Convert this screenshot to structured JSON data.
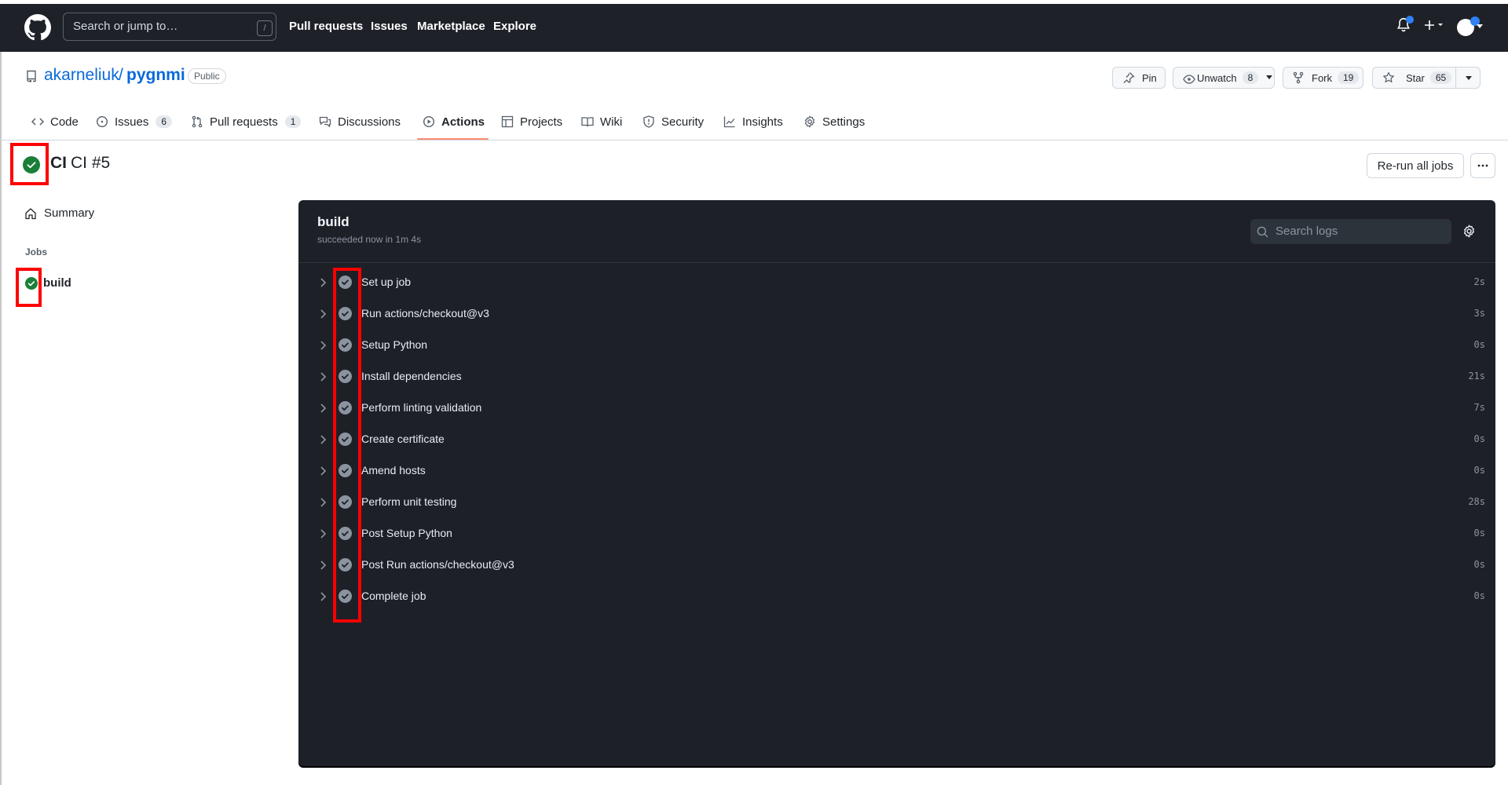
{
  "header": {
    "search_placeholder": "Search or jump to…",
    "search_shortcut": "/",
    "nav": [
      "Pull requests",
      "Issues",
      "Marketplace",
      "Explore"
    ],
    "icons": [
      "github-logo-icon",
      "bell-icon",
      "plus-icon",
      "avatar"
    ]
  },
  "repo": {
    "owner": "akarneliuk",
    "separator": "/",
    "name": "pygnmi",
    "visibility": "Public",
    "actions": {
      "pin_label": "Pin",
      "watch_label": "Unwatch",
      "watch_count": "8",
      "fork_label": "Fork",
      "fork_count": "19",
      "star_label": "Star",
      "star_count": "65"
    }
  },
  "tabs": [
    {
      "label": "Code",
      "icon": "code-icon"
    },
    {
      "label": "Issues",
      "icon": "issue-icon",
      "count": "6"
    },
    {
      "label": "Pull requests",
      "icon": "pull-request-icon",
      "count": "1"
    },
    {
      "label": "Discussions",
      "icon": "discussions-icon"
    },
    {
      "label": "Actions",
      "icon": "play-icon",
      "active": true
    },
    {
      "label": "Projects",
      "icon": "table-icon"
    },
    {
      "label": "Wiki",
      "icon": "book-icon"
    },
    {
      "label": "Security",
      "icon": "shield-icon"
    },
    {
      "label": "Insights",
      "icon": "graph-icon"
    },
    {
      "label": "Settings",
      "icon": "gear-icon"
    }
  ],
  "run": {
    "status": "success",
    "workflow": "CI",
    "name": "CI #5",
    "rerun_label": "Re-run all jobs",
    "more_label": "···"
  },
  "sidebar": {
    "summary_label": "Summary",
    "jobs_heading": "Jobs",
    "jobs": [
      {
        "name": "build",
        "status": "success"
      }
    ]
  },
  "log_panel": {
    "job_name": "build",
    "status_text": "succeeded now in 1m 4s",
    "search_placeholder": "Search logs",
    "steps": [
      {
        "name": "Set up job",
        "duration": "2s"
      },
      {
        "name": "Run actions/checkout@v3",
        "duration": "3s"
      },
      {
        "name": "Setup Python",
        "duration": "0s"
      },
      {
        "name": "Install dependencies",
        "duration": "21s"
      },
      {
        "name": "Perform linting validation",
        "duration": "7s"
      },
      {
        "name": "Create certificate",
        "duration": "0s"
      },
      {
        "name": "Amend hosts",
        "duration": "0s"
      },
      {
        "name": "Perform unit testing",
        "duration": "28s"
      },
      {
        "name": "Post Setup Python",
        "duration": "0s"
      },
      {
        "name": "Post Run actions/checkout@v3",
        "duration": "0s"
      },
      {
        "name": "Complete job",
        "duration": "0s"
      }
    ]
  },
  "colors": {
    "header_bg": "#1e2228",
    "link": "#0969da",
    "success": "#1a7f37",
    "tab_underline": "#fd8c73",
    "log_bg": "#1e2028",
    "annotation": "#ff0000"
  }
}
